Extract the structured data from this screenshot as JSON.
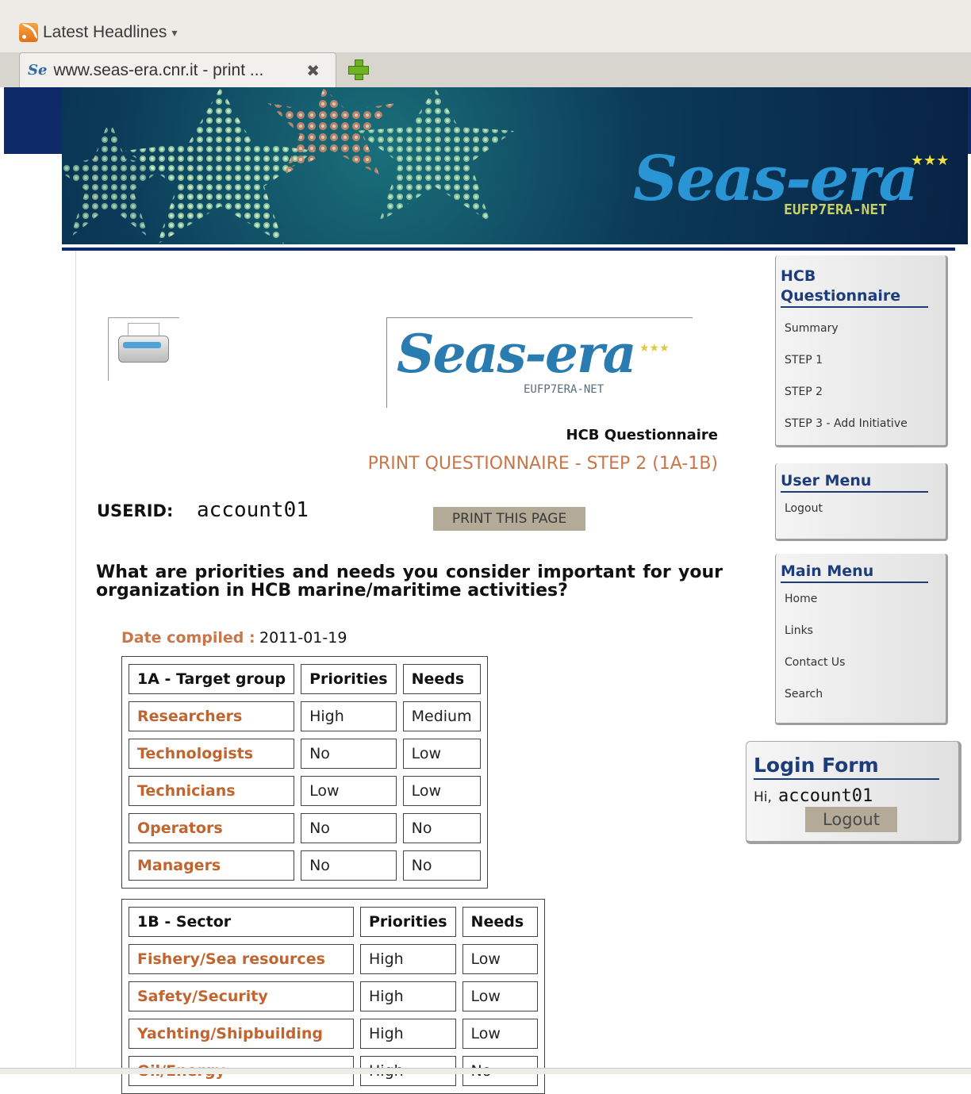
{
  "browser": {
    "bookmark_label": "Latest Headlines",
    "bookmark_caret": "▾",
    "tab_title": "www.seas-era.cnr.it - print ...",
    "tab_close_glyph": "✖",
    "favicon_text": "Se"
  },
  "banner": {
    "logo_text": "Seas-era",
    "logo_subtitle": "EUFP7ERA-NET",
    "stars": "★★★"
  },
  "header": {
    "logo_text": "Seas-era",
    "logo_subtitle": "EUFP7ERA-NET",
    "logo_stars": "★★★",
    "section_title": "HCB Questionnaire",
    "page_title": "PRINT QUESTIONNAIRE - STEP 2 (1A-1B)"
  },
  "user": {
    "userid_label": "USERID:",
    "userid_value": "account01"
  },
  "actions": {
    "print_label": "PRINT THIS PAGE"
  },
  "question": "What are priorities and needs you consider important for your organization in HCB marine/maritime activities?",
  "date": {
    "label": "Date compiled :",
    "value": "2011-01-19"
  },
  "table_1a": {
    "headers": [
      "1A - Target group",
      "Priorities",
      "Needs"
    ],
    "rows": [
      [
        "Researchers",
        "High",
        "Medium"
      ],
      [
        "Technologists",
        "No",
        "Low"
      ],
      [
        "Technicians",
        "Low",
        "Low"
      ],
      [
        "Operators",
        "No",
        "No"
      ],
      [
        "Managers",
        "No",
        "No"
      ]
    ]
  },
  "table_1b": {
    "headers": [
      "1B - Sector",
      "Priorities",
      "Needs"
    ],
    "rows": [
      [
        "Fishery/Sea resources",
        "High",
        "Low"
      ],
      [
        "Safety/Security",
        "High",
        "Low"
      ],
      [
        "Yachting/Shipbuilding",
        "High",
        "Low"
      ],
      [
        "Oil/Energy",
        "High",
        "No"
      ]
    ]
  },
  "sidebar": {
    "hcb": {
      "title_line1": "HCB",
      "title_line2": "Questionnaire",
      "items": [
        "Summary",
        "STEP 1",
        "STEP 2",
        "STEP 3 - Add Initiative"
      ]
    },
    "user_menu": {
      "title": "User Menu",
      "items": [
        "Logout"
      ]
    },
    "main_menu": {
      "title": "Main Menu",
      "items": [
        "Home",
        "Links",
        "Contact Us",
        "Search"
      ]
    }
  },
  "login": {
    "title": "Login Form",
    "greeting": "Hi,",
    "username": "account01",
    "logout_label": "Logout"
  },
  "colors": {
    "accent_orange": "#c0652f",
    "menu_blue": "#1d3d7a",
    "button_bg": "#b4aa98",
    "banner_dark": "#0f2a68"
  }
}
